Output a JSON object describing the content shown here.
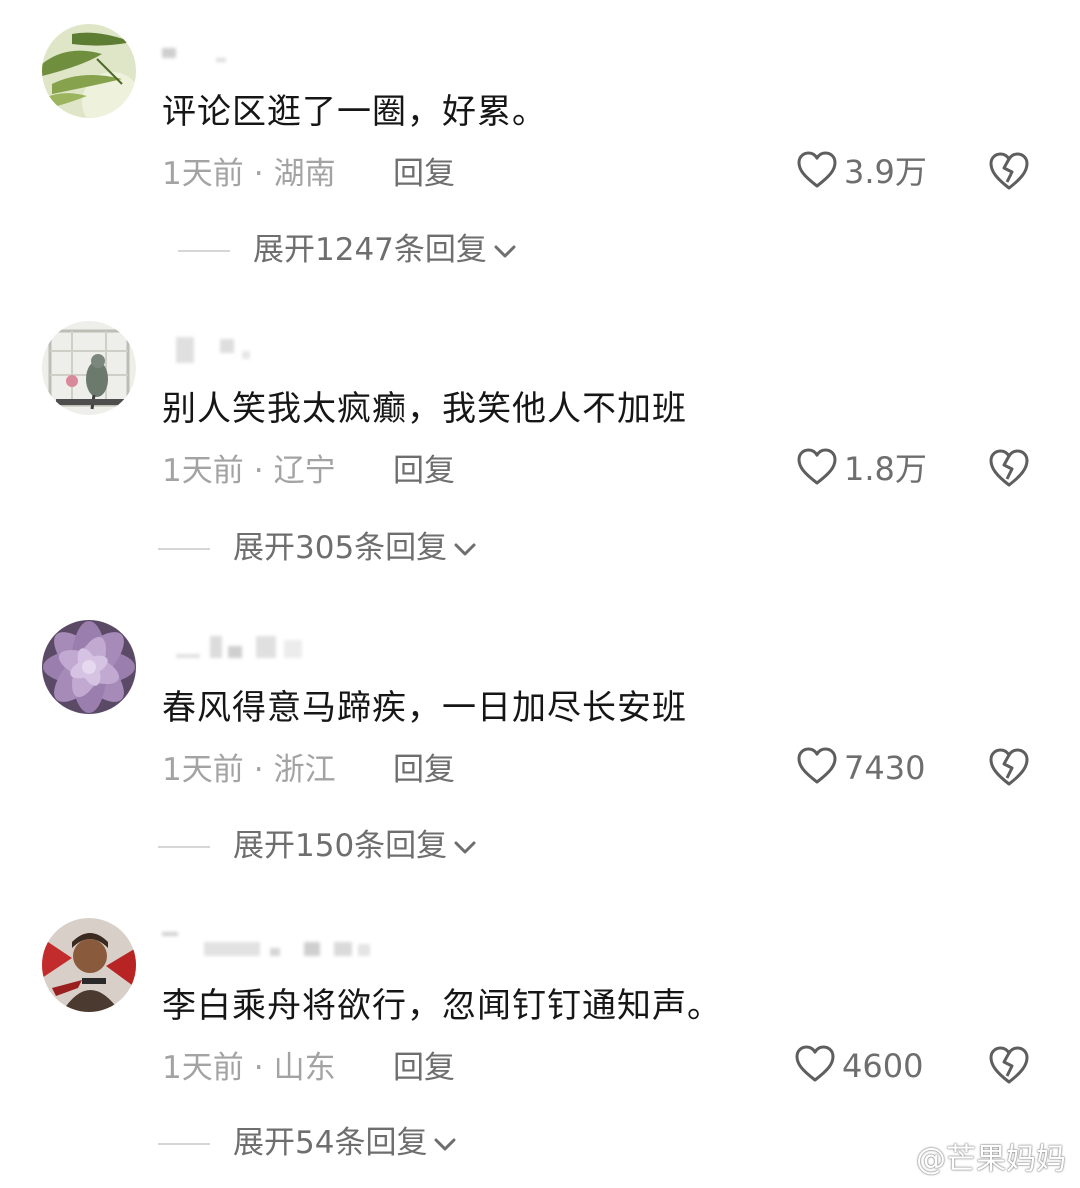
{
  "comments": [
    {
      "text": "评论区逛了一圈，好累。",
      "time": "1天前",
      "separator": "·",
      "location": "湖南",
      "reply_label": "回复",
      "likes": "3.9万",
      "expand_label": "展开1247条回复",
      "avatar_icon": "bamboo-avatar"
    },
    {
      "text": "别人笑我太疯癫，我笑他人不加班",
      "time": "1天前",
      "separator": "·",
      "location": "辽宁",
      "reply_label": "回复",
      "likes": "1.8万",
      "expand_label": "展开305条回复",
      "avatar_icon": "parrot-avatar"
    },
    {
      "text": "春风得意马蹄疾，一日加尽长安班",
      "time": "1天前",
      "separator": "·",
      "location": "浙江",
      "reply_label": "回复",
      "likes": "7430",
      "expand_label": "展开150条回复",
      "avatar_icon": "succulent-avatar"
    },
    {
      "text": "李白乘舟将欲行，忽闻钉钉通知声。",
      "time": "1天前",
      "separator": "·",
      "location": "山东",
      "reply_label": "回复",
      "likes": "4600",
      "expand_label": "展开54条回复",
      "avatar_icon": "warrior-avatar"
    }
  ],
  "icons": {
    "like": "heart-outline-icon",
    "dislike": "broken-heart-icon",
    "expand": "chevron-down-icon",
    "watermark": "weibo-logo-icon"
  },
  "watermark": {
    "text": "@芒果妈妈"
  },
  "colors": {
    "primary_text": "#161616",
    "secondary_text": "#a3a3a3",
    "action_text": "#6e6e6e"
  }
}
